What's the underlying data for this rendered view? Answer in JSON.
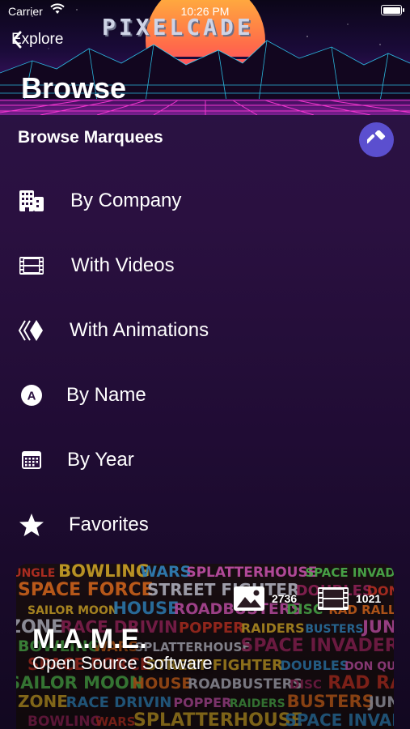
{
  "status_bar": {
    "carrier": "Carrier",
    "time": "10:26 PM"
  },
  "header": {
    "back_label": "Explore",
    "logo_text": "PIXELCADE",
    "title": "Browse"
  },
  "section": {
    "title": "Browse Marquees"
  },
  "menu": [
    {
      "label": "By Company",
      "icon": "building-icon"
    },
    {
      "label": "With Videos",
      "icon": "film-icon"
    },
    {
      "label": "With Animations",
      "icon": "animation-icon"
    },
    {
      "label": "By Name",
      "icon": "letter-a-icon"
    },
    {
      "label": "By Year",
      "icon": "calendar-icon"
    },
    {
      "label": "Favorites",
      "icon": "star-icon"
    }
  ],
  "card": {
    "title": "M.A.M.E.",
    "subtitle": "Open Source Software",
    "image_count": "2736",
    "video_count": "1021",
    "collage_words": [
      "JUNGLE",
      "BOWLING",
      "WARS",
      "SPLATTERHOUSE",
      "SPACE INVADERS",
      "SPACE FORCE",
      "STREET FIGHTER",
      "DOUBLES",
      "DON QUIXOTE",
      "SAILOR MOON",
      "HOUSE",
      "ROADBUSTERS",
      "DISC",
      "RAD RALLY",
      "ZONE",
      "RACE DRIVIN",
      "POPPER",
      "RAIDERS",
      "BUSTERS"
    ]
  },
  "colors": {
    "accent": "#5b4fcf",
    "background_top": "#2b1446",
    "background_bottom": "#120820",
    "sunset_top": "#ffb03a",
    "sunset_bottom": "#ff2e8a",
    "grid": "#ff3ad8"
  }
}
